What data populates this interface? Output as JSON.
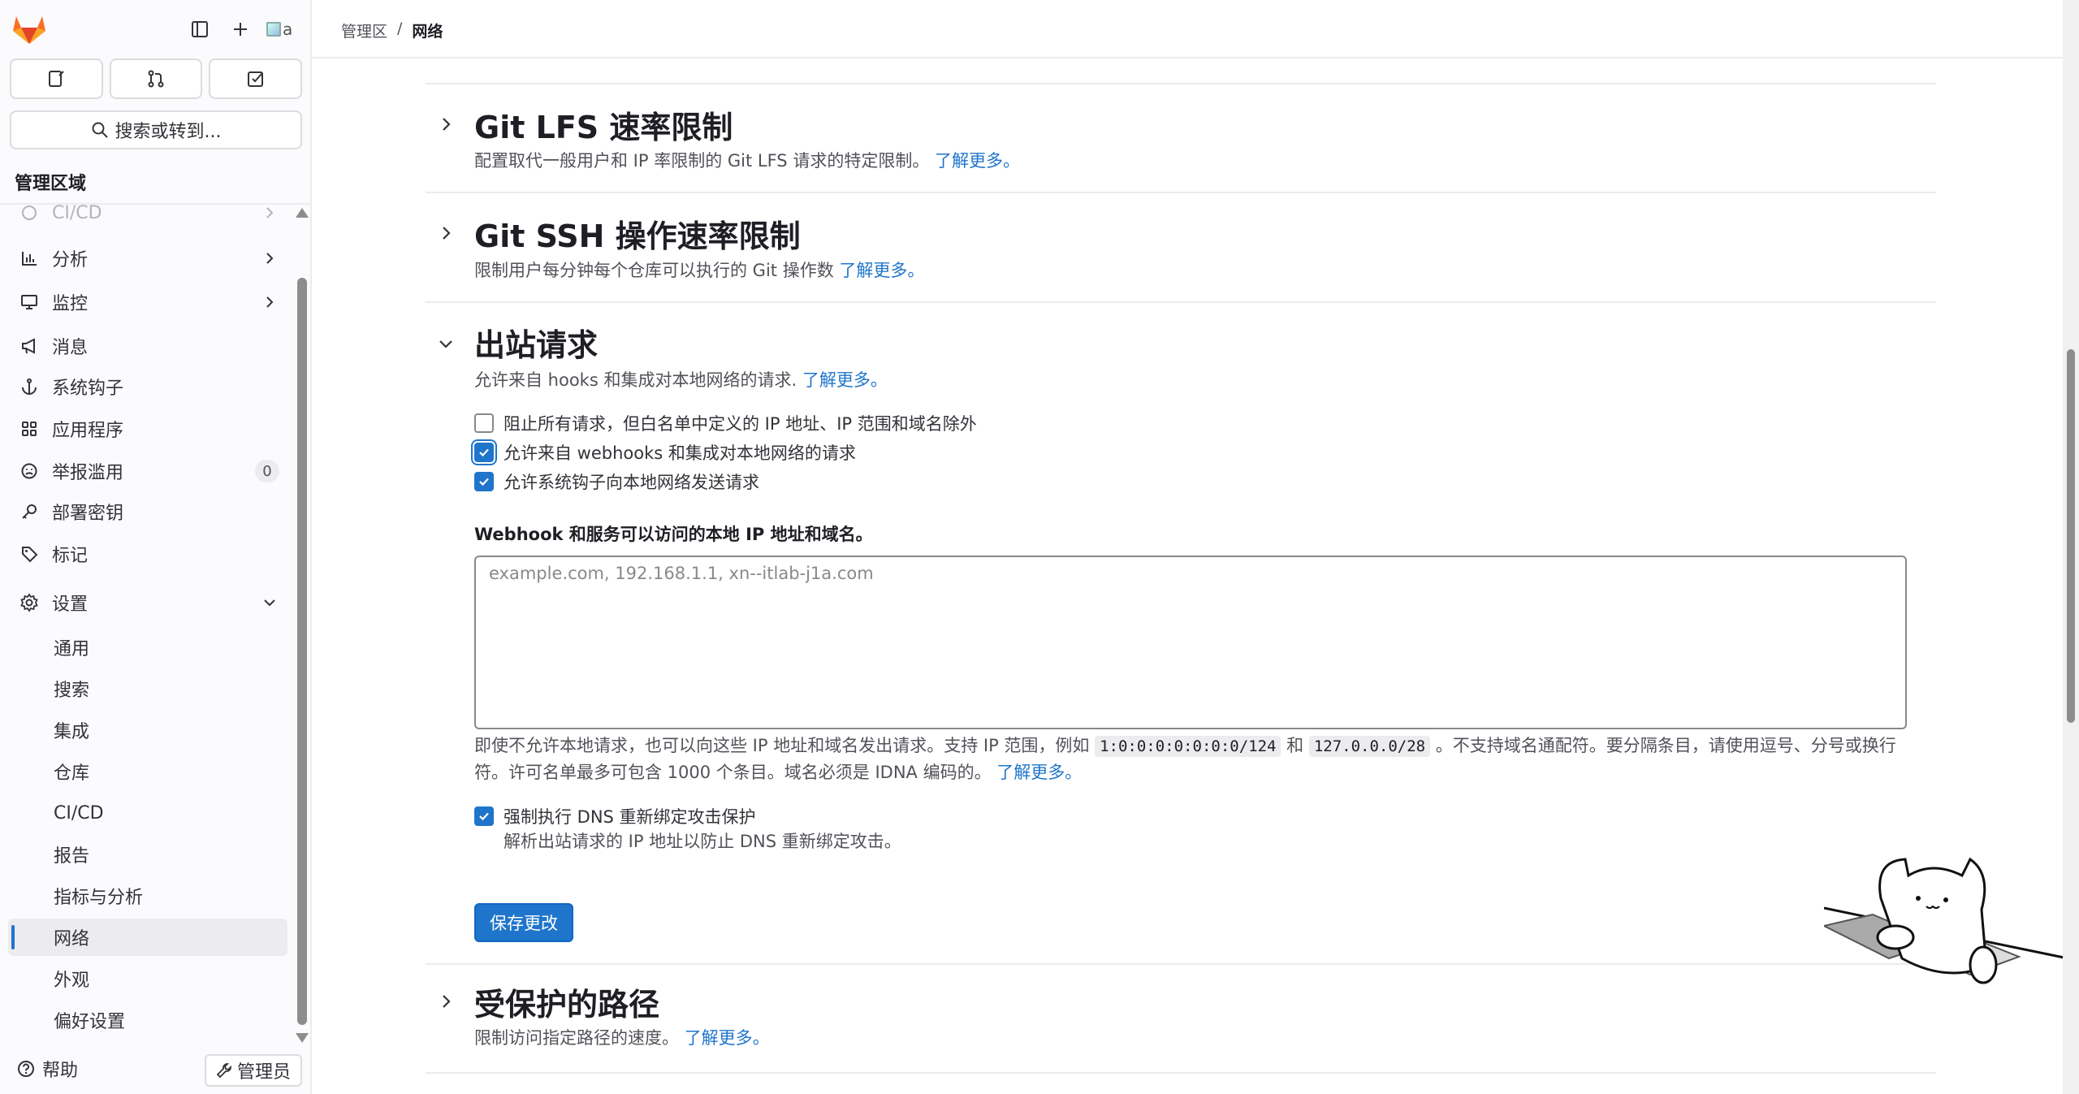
{
  "sidebar": {
    "area_title": "管理区域",
    "search_label": "搜索或转到...",
    "avatar_alt": "a",
    "nav": [
      {
        "label": "CI/CD",
        "icon": "rocket-icon"
      },
      {
        "label": "分析",
        "icon": "chart-icon"
      },
      {
        "label": "监控",
        "icon": "monitor-icon"
      },
      {
        "label": "消息",
        "icon": "bullhorn-icon"
      },
      {
        "label": "系统钩子",
        "icon": "anchor-icon"
      },
      {
        "label": "应用程序",
        "icon": "apps-icon"
      },
      {
        "label": "举报滥用",
        "icon": "abuse-icon",
        "badge": "0"
      },
      {
        "label": "部署密钥",
        "icon": "key-icon"
      },
      {
        "label": "标记",
        "icon": "label-icon"
      },
      {
        "label": "设置",
        "icon": "gear-icon"
      }
    ],
    "settings_sub": [
      "通用",
      "搜索",
      "集成",
      "仓库",
      "CI/CD",
      "报告",
      "指标与分析",
      "网络",
      "外观",
      "偏好设置"
    ],
    "help_label": "帮助",
    "admin_label": "管理员"
  },
  "breadcrumb": {
    "root": "管理区",
    "sep": "/",
    "current": "网络"
  },
  "sections": {
    "lfs": {
      "title": "Git LFS 速率限制",
      "desc": "配置取代一般用户和 IP 率限制的 Git LFS 请求的特定限制。",
      "link": "了解更多。"
    },
    "ssh": {
      "title": "Git SSH 操作速率限制",
      "desc": "限制用户每分钟每个仓库可以执行的 Git 操作数",
      "link": "了解更多。"
    },
    "outbound": {
      "title": "出站请求",
      "desc": "允许来自 hooks 和集成对本地网络的请求.",
      "link": "了解更多。",
      "cb_block_all": "阻止所有请求，但白名单中定义的 IP 地址、IP 范围和域名除外",
      "cb_allow_webhooks": "允许来自 webhooks 和集成对本地网络的请求",
      "cb_allow_system_hooks": "允许系统钩子向本地网络发送请求",
      "allowlist_label": "Webhook 和服务可以访问的本地 IP 地址和域名。",
      "allowlist_placeholder": "example.com, 192.168.1.1, xn--itlab-j1a.com",
      "help_1": "即使不允许本地请求，也可以向这些 IP 地址和域名发出请求。支持 IP 范围，例如",
      "code_1": "1:0:0:0:0:0:0:0/124",
      "help_and": "和",
      "code_2": "127.0.0.0/28",
      "help_2": "。不支持域名通配符。要分隔条目，请使用逗号、分号或换行符。许可名单最多可包含 1000 个条目。域名必须是 IDNA 编码的。",
      "help_link": "了解更多。",
      "cb_dns": "强制执行 DNS 重新绑定攻击保护",
      "dns_help": "解析出站请求的 IP 地址以防止 DNS 重新绑定攻击。",
      "save": "保存更改"
    },
    "protected": {
      "title": "受保护的路径",
      "desc": "限制访问指定路径的速度。",
      "link": "了解更多。"
    }
  },
  "colors": {
    "accent": "#1f75cb",
    "sidebar_bg": "#fbfafd",
    "text": "#333238"
  }
}
